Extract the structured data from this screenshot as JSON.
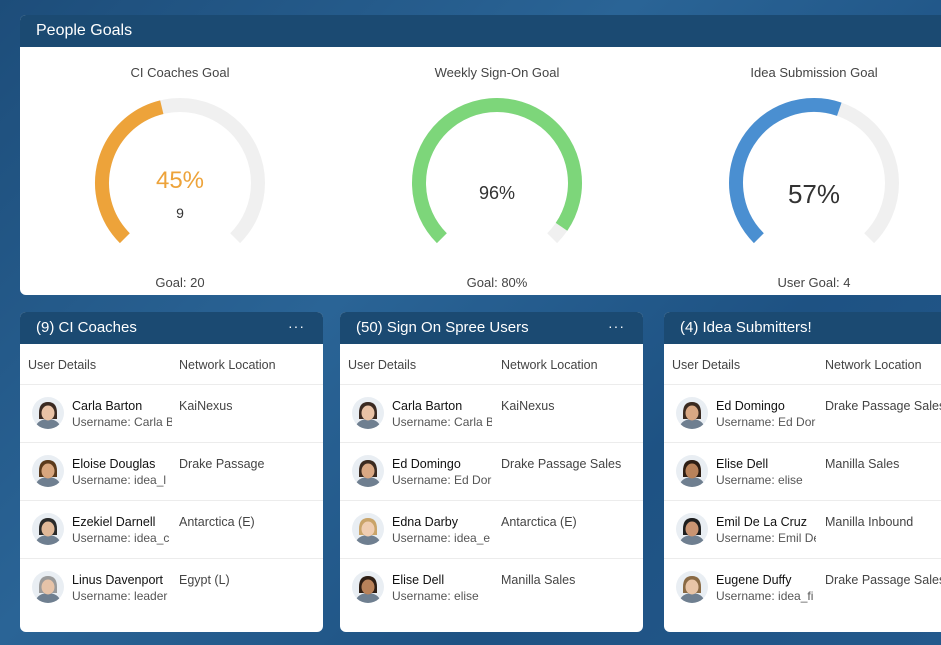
{
  "goals": {
    "title": "People Goals",
    "gauges": [
      {
        "title": "CI Coaches Goal",
        "percent_label": "45%",
        "fraction": 0.45,
        "sub_value": "9",
        "goal_label": "Goal: 20",
        "color": "#eda33a"
      },
      {
        "title": "Weekly Sign-On Goal",
        "percent_label": "96%",
        "fraction": 0.96,
        "sub_value": "",
        "goal_label": "Goal: 80%",
        "color": "#7dd67a"
      },
      {
        "title": "Idea Submission Goal",
        "percent_label": "57%",
        "fraction": 0.57,
        "sub_value": "",
        "goal_label": "User Goal: 4",
        "color": "#4a8fd1"
      }
    ]
  },
  "panels": [
    {
      "title": "(9) CI Coaches",
      "menu": "···",
      "columns": [
        "User Details",
        "Network Location"
      ],
      "rows": [
        {
          "name": "Carla Barton",
          "username": "Username: Carla B",
          "location": "KaiNexus",
          "avatar": "woman-dark-hair"
        },
        {
          "name": "Eloise Douglas",
          "username": "Username: idea_l",
          "location": "Drake Passage",
          "avatar": "woman-curly-hair"
        },
        {
          "name": "Ezekiel Darnell",
          "username": "Username: idea_c",
          "location": "Antarctica (E)",
          "avatar": "man-dark-hair"
        },
        {
          "name": "Linus Davenport",
          "username": "Username: leader",
          "location": "Egypt (L)",
          "avatar": "man-gray-hair"
        }
      ]
    },
    {
      "title": "(50) Sign On Spree Users",
      "menu": "···",
      "columns": [
        "User Details",
        "Network Location"
      ],
      "rows": [
        {
          "name": "Carla Barton",
          "username": "Username: Carla B",
          "location": "KaiNexus",
          "avatar": "woman-dark-hair"
        },
        {
          "name": "Ed Domingo",
          "username": "Username: Ed Dor",
          "location": "Drake Passage Sales",
          "avatar": "man-beard"
        },
        {
          "name": "Edna Darby",
          "username": "Username: idea_e",
          "location": "Antarctica (E)",
          "avatar": "woman-light-hair"
        },
        {
          "name": "Elise Dell",
          "username": "Username: elise",
          "location": "Manilla Sales",
          "avatar": "woman-curly-dark"
        }
      ]
    },
    {
      "title": "(4) Idea Submitters!",
      "menu": "",
      "columns": [
        "User Details",
        "Network Location"
      ],
      "rows": [
        {
          "name": "Ed Domingo",
          "username": "Username: Ed Dor",
          "location": "Drake Passage Sales",
          "avatar": "man-beard"
        },
        {
          "name": "Elise Dell",
          "username": "Username: elise",
          "location": "Manilla Sales",
          "avatar": "woman-curly-dark"
        },
        {
          "name": "Emil De La Cruz",
          "username": "Username: Emil De",
          "location": "Manilla Inbound",
          "avatar": "man-smiling"
        },
        {
          "name": "Eugene Duffy",
          "username": "Username: idea_fi",
          "location": "Drake Passage Sales",
          "avatar": "man-light-hair"
        }
      ]
    }
  ]
}
